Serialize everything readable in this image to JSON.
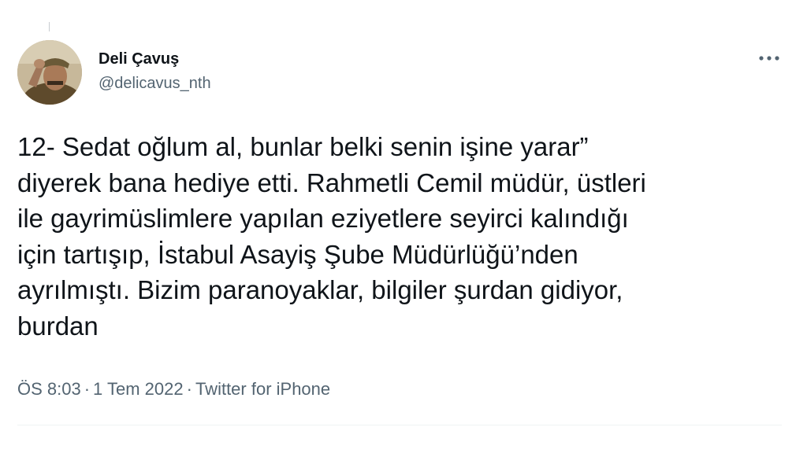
{
  "tweet": {
    "author": {
      "display_name": "Deli Çavuş",
      "handle": "@delicavus_nth"
    },
    "text": "12- Sedat oğlum al, bunlar belki senin işine yarar”\ndiyerek bana hediye etti. Rahmetli Cemil müdür, üstleri\nile gayrimüslimlere yapılan eziyetlere seyirci kalındığı\niçin tartışıp, İstabul Asayiş Şube Müdürlüğü’nden\nayrılmıştı. Bizim paranoyaklar, bilgiler şurdan gidiyor,\nburdan",
    "time": "ÖS 8:03",
    "date": "1 Tem 2022",
    "separator": "·",
    "source": "Twitter for iPhone",
    "more_icon": "more-horizontal-icon"
  },
  "colors": {
    "text_primary": "#0f1419",
    "text_secondary": "#536471",
    "divider": "#eff3f4"
  }
}
